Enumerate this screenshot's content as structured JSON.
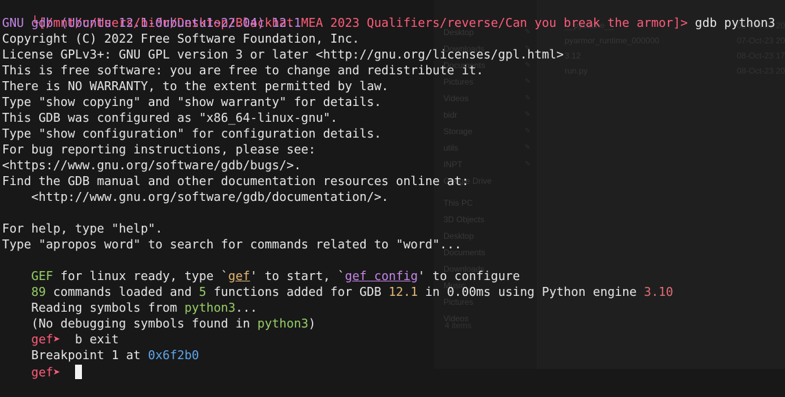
{
  "background_explorer": {
    "nav_items": [
      "Desktop",
      "Downloads",
      "Documents",
      "Pictures",
      "Videos",
      "bidr",
      "Storage",
      "utils",
      "INPT",
      "Google Drive",
      "This PC",
      "3D Objects",
      "Desktop",
      "Documents",
      "Downloads",
      "Music",
      "Pictures",
      "Videos"
    ],
    "files": [
      "__pycache__",
      "pyarmor_runtime_000000",
      "3.12",
      "run.py"
    ],
    "dates": [
      "08-Oct-23 20:",
      "07-Oct-23 20:",
      "08-Oct-23 17:",
      "08-Oct-23 20:"
    ],
    "status": "4 items"
  },
  "terminal": {
    "prompt_path": "└[/mnt/c/Users/bidr/Desktop/Blackhat MEA 2023 Qualifiers/reverse/Can you break the armor]",
    "prompt_arrow": ">",
    "command": " gdb python3",
    "banner_title": "GNU gdb (Ubuntu 12.1-0ubuntu1~22.04) 12.1",
    "banner_lines": [
      "Copyright (C) 2022 Free Software Foundation, Inc.",
      "License GPLv3+: GNU GPL version 3 or later <http://gnu.org/licenses/gpl.html>",
      "This is free software: you are free to change and redistribute it.",
      "There is NO WARRANTY, to the extent permitted by law.",
      "Type \"show copying\" and \"show warranty\" for details.",
      "This GDB was configured as \"x86_64-linux-gnu\".",
      "Type \"show configuration\" for configuration details.",
      "For bug reporting instructions, please see:",
      "<https://www.gnu.org/software/gdb/bugs/>.",
      "Find the GDB manual and other documentation resources online at:",
      "    <http://www.gnu.org/software/gdb/documentation/>.",
      "",
      "For help, type \"help\".",
      "Type \"apropos word\" to search for commands related to \"word\"..."
    ],
    "gef_ready": {
      "gef": "GEF",
      "t1": " for linux ready, type `",
      "cmd1": "gef",
      "t2": "' to start, `",
      "cmd2": "gef config",
      "t3": "' to configure"
    },
    "loaded": {
      "n_commands": "89",
      "t1": " commands loaded and ",
      "n_functions": "5",
      "t2": " functions added for GDB ",
      "gdb_version": "12.1",
      "t3": " in 0.00ms using Python engine ",
      "py_version": "3.10"
    },
    "reading": {
      "t1": "Reading symbols from ",
      "name": "python3",
      "t2": "..."
    },
    "nodebug": {
      "t1": "(No debugging symbols found in ",
      "name": "python3",
      "t2": ")"
    },
    "gef_prompt": "gef➤",
    "cmd_break": "  b exit",
    "breakpoint": {
      "t1": "Breakpoint 1 at ",
      "addr": "0x6f2b0"
    }
  }
}
